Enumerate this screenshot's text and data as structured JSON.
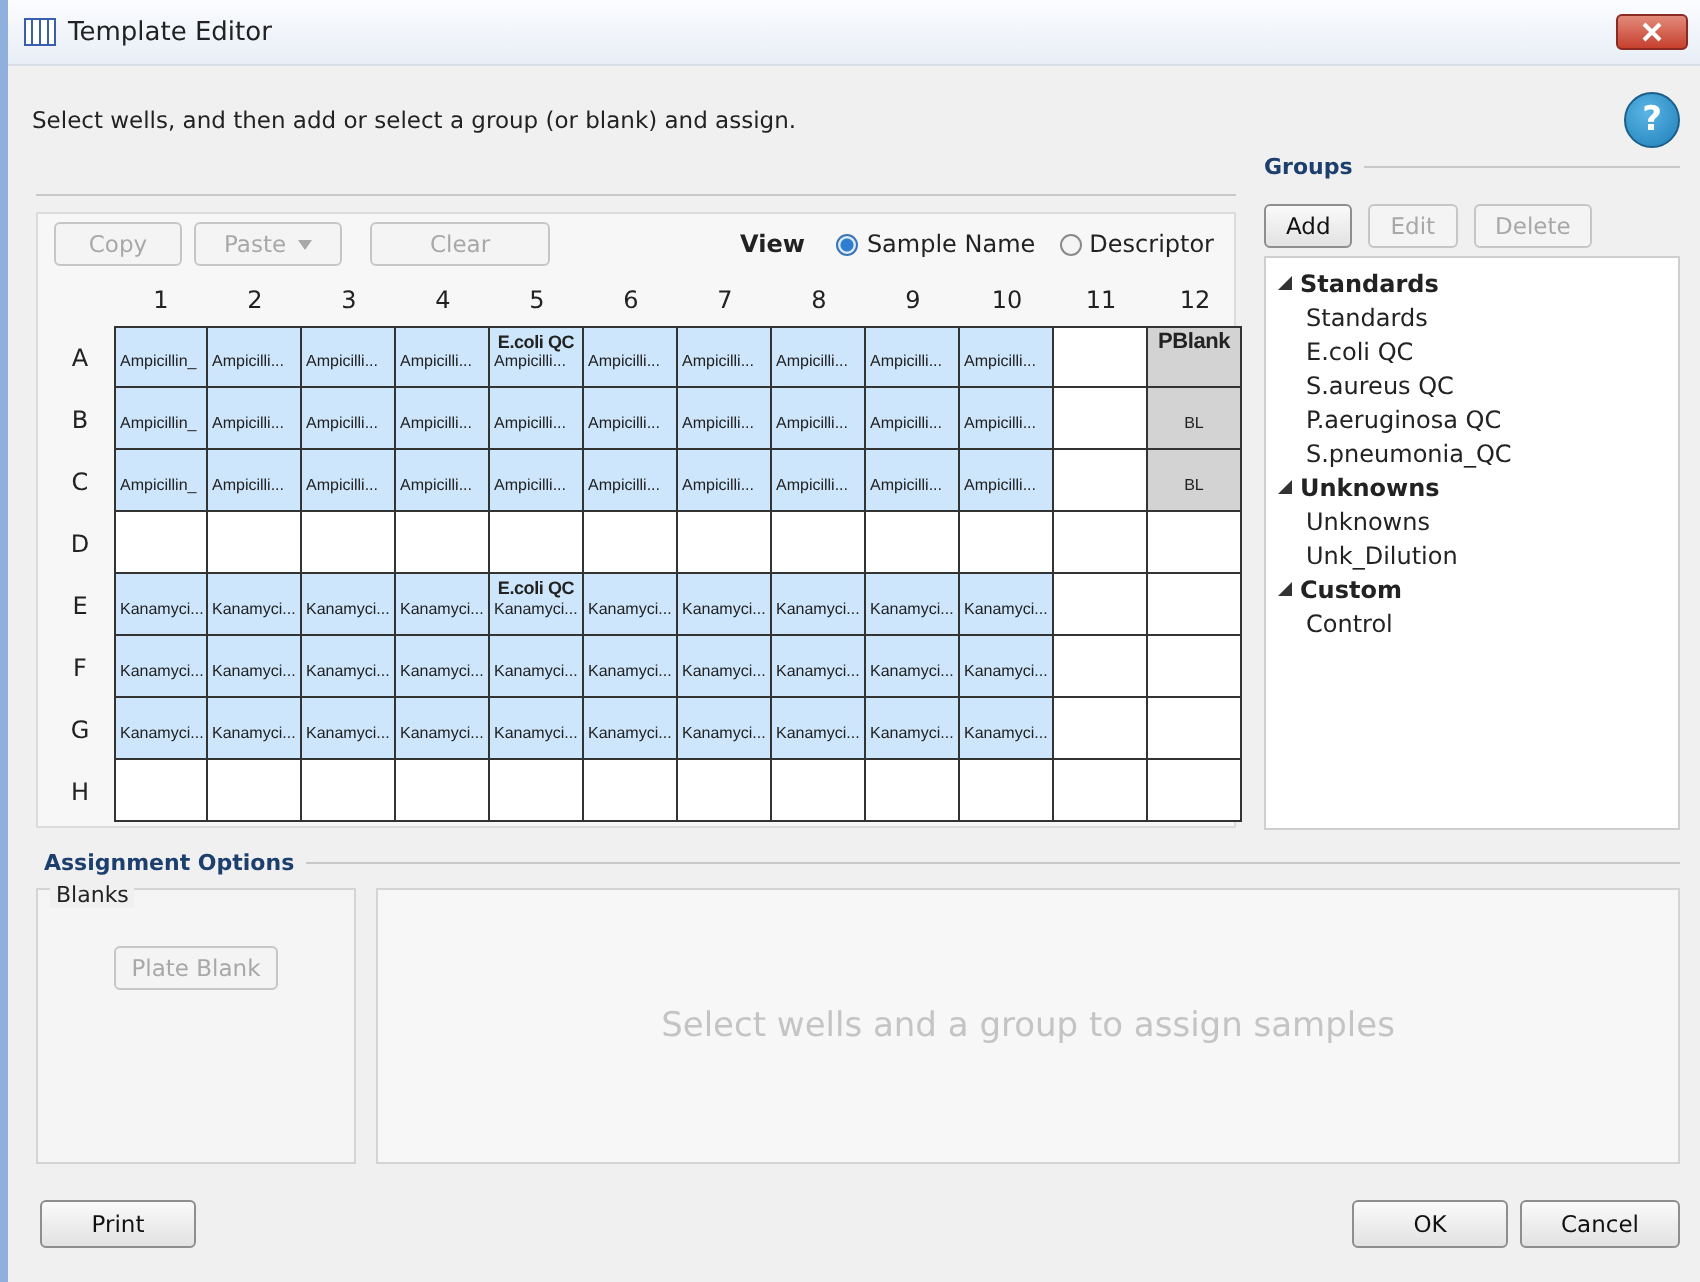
{
  "window": {
    "title": "Template Editor"
  },
  "instruction": "Select wells, and then add or select a group (or blank) and assign.",
  "help": "?",
  "toolbar": {
    "buttons": [
      {
        "label": "Copy",
        "disabled": true,
        "dropdown": false
      },
      {
        "label": "Paste",
        "disabled": true,
        "dropdown": true
      },
      {
        "label": "Clear",
        "disabled": true,
        "dropdown": false
      }
    ],
    "view_label": "View",
    "view_options": [
      {
        "label": "Sample Name",
        "selected": true
      },
      {
        "label": "Descriptor",
        "selected": false
      }
    ]
  },
  "plate": {
    "columns": [
      "1",
      "2",
      "3",
      "4",
      "5",
      "6",
      "7",
      "8",
      "9",
      "10",
      "11",
      "12"
    ],
    "rows": [
      {
        "label": "A",
        "wells": [
          {
            "kind": "sample",
            "text": "Ampicillin_"
          },
          {
            "kind": "sample",
            "text": "Ampicilli..."
          },
          {
            "kind": "sample",
            "text": "Ampicilli..."
          },
          {
            "kind": "sample",
            "text": "Ampicilli..."
          },
          {
            "kind": "sample",
            "text": "Ampicilli...",
            "group_label": "E.coli QC"
          },
          {
            "kind": "sample",
            "text": "Ampicilli..."
          },
          {
            "kind": "sample",
            "text": "Ampicilli..."
          },
          {
            "kind": "sample",
            "text": "Ampicilli..."
          },
          {
            "kind": "sample",
            "text": "Ampicilli..."
          },
          {
            "kind": "sample",
            "text": "Ampicilli..."
          },
          {
            "kind": "empty"
          },
          {
            "kind": "blank",
            "group_label": "PBlank"
          }
        ]
      },
      {
        "label": "B",
        "wells": [
          {
            "kind": "sample",
            "text": "Ampicillin_"
          },
          {
            "kind": "sample",
            "text": "Ampicilli..."
          },
          {
            "kind": "sample",
            "text": "Ampicilli..."
          },
          {
            "kind": "sample",
            "text": "Ampicilli..."
          },
          {
            "kind": "sample",
            "text": "Ampicilli..."
          },
          {
            "kind": "sample",
            "text": "Ampicilli..."
          },
          {
            "kind": "sample",
            "text": "Ampicilli..."
          },
          {
            "kind": "sample",
            "text": "Ampicilli..."
          },
          {
            "kind": "sample",
            "text": "Ampicilli..."
          },
          {
            "kind": "sample",
            "text": "Ampicilli..."
          },
          {
            "kind": "empty"
          },
          {
            "kind": "blank",
            "text": "BL"
          }
        ]
      },
      {
        "label": "C",
        "wells": [
          {
            "kind": "sample",
            "text": "Ampicillin_"
          },
          {
            "kind": "sample",
            "text": "Ampicilli..."
          },
          {
            "kind": "sample",
            "text": "Ampicilli..."
          },
          {
            "kind": "sample",
            "text": "Ampicilli..."
          },
          {
            "kind": "sample",
            "text": "Ampicilli..."
          },
          {
            "kind": "sample",
            "text": "Ampicilli..."
          },
          {
            "kind": "sample",
            "text": "Ampicilli..."
          },
          {
            "kind": "sample",
            "text": "Ampicilli..."
          },
          {
            "kind": "sample",
            "text": "Ampicilli..."
          },
          {
            "kind": "sample",
            "text": "Ampicilli..."
          },
          {
            "kind": "empty"
          },
          {
            "kind": "blank",
            "text": "BL"
          }
        ]
      },
      {
        "label": "D",
        "wells": [
          {
            "kind": "empty"
          },
          {
            "kind": "empty"
          },
          {
            "kind": "empty"
          },
          {
            "kind": "empty"
          },
          {
            "kind": "empty"
          },
          {
            "kind": "empty"
          },
          {
            "kind": "empty"
          },
          {
            "kind": "empty"
          },
          {
            "kind": "empty"
          },
          {
            "kind": "empty"
          },
          {
            "kind": "empty"
          },
          {
            "kind": "empty"
          }
        ]
      },
      {
        "label": "E",
        "wells": [
          {
            "kind": "sample",
            "text": "Kanamyci..."
          },
          {
            "kind": "sample",
            "text": "Kanamyci..."
          },
          {
            "kind": "sample",
            "text": "Kanamyci..."
          },
          {
            "kind": "sample",
            "text": "Kanamyci..."
          },
          {
            "kind": "sample",
            "text": "Kanamyci...",
            "group_label": "E.coli QC"
          },
          {
            "kind": "sample",
            "text": "Kanamyci..."
          },
          {
            "kind": "sample",
            "text": "Kanamyci..."
          },
          {
            "kind": "sample",
            "text": "Kanamyci..."
          },
          {
            "kind": "sample",
            "text": "Kanamyci..."
          },
          {
            "kind": "sample",
            "text": "Kanamyci..."
          },
          {
            "kind": "empty"
          },
          {
            "kind": "empty"
          }
        ]
      },
      {
        "label": "F",
        "wells": [
          {
            "kind": "sample",
            "text": "Kanamyci..."
          },
          {
            "kind": "sample",
            "text": "Kanamyci..."
          },
          {
            "kind": "sample",
            "text": "Kanamyci..."
          },
          {
            "kind": "sample",
            "text": "Kanamyci..."
          },
          {
            "kind": "sample",
            "text": "Kanamyci..."
          },
          {
            "kind": "sample",
            "text": "Kanamyci..."
          },
          {
            "kind": "sample",
            "text": "Kanamyci..."
          },
          {
            "kind": "sample",
            "text": "Kanamyci..."
          },
          {
            "kind": "sample",
            "text": "Kanamyci..."
          },
          {
            "kind": "sample",
            "text": "Kanamyci..."
          },
          {
            "kind": "empty"
          },
          {
            "kind": "empty"
          }
        ]
      },
      {
        "label": "G",
        "wells": [
          {
            "kind": "sample",
            "text": "Kanamyci..."
          },
          {
            "kind": "sample",
            "text": "Kanamyci..."
          },
          {
            "kind": "sample",
            "text": "Kanamyci..."
          },
          {
            "kind": "sample",
            "text": "Kanamyci..."
          },
          {
            "kind": "sample",
            "text": "Kanamyci..."
          },
          {
            "kind": "sample",
            "text": "Kanamyci..."
          },
          {
            "kind": "sample",
            "text": "Kanamyci..."
          },
          {
            "kind": "sample",
            "text": "Kanamyci..."
          },
          {
            "kind": "sample",
            "text": "Kanamyci..."
          },
          {
            "kind": "sample",
            "text": "Kanamyci..."
          },
          {
            "kind": "empty"
          },
          {
            "kind": "empty"
          }
        ]
      },
      {
        "label": "H",
        "wells": [
          {
            "kind": "empty"
          },
          {
            "kind": "empty"
          },
          {
            "kind": "empty"
          },
          {
            "kind": "empty"
          },
          {
            "kind": "empty"
          },
          {
            "kind": "empty"
          },
          {
            "kind": "empty"
          },
          {
            "kind": "empty"
          },
          {
            "kind": "empty"
          },
          {
            "kind": "empty"
          },
          {
            "kind": "empty"
          },
          {
            "kind": "empty"
          }
        ]
      }
    ]
  },
  "groups": {
    "title": "Groups",
    "buttons": [
      {
        "label": "Add",
        "disabled": false
      },
      {
        "label": "Edit",
        "disabled": true
      },
      {
        "label": "Delete",
        "disabled": true
      }
    ],
    "tree": [
      {
        "label": "Standards",
        "expanded": true,
        "children": [
          {
            "label": "Standards"
          },
          {
            "label": "E.coli QC"
          },
          {
            "label": "S.aureus QC"
          },
          {
            "label": "P.aeruginosa QC"
          },
          {
            "label": "S.pneumonia_QC"
          }
        ]
      },
      {
        "label": "Unknowns",
        "expanded": true,
        "children": [
          {
            "label": "Unknowns"
          },
          {
            "label": "Unk_Dilution"
          }
        ]
      },
      {
        "label": "Custom",
        "expanded": true,
        "children": [
          {
            "label": "Control"
          }
        ]
      }
    ]
  },
  "assignment": {
    "title": "Assignment Options",
    "blanks": {
      "title": "Blanks",
      "button": {
        "label": "Plate Blank",
        "disabled": true
      }
    },
    "message": "Select wells and a group to assign samples"
  },
  "footer": {
    "left": [
      {
        "label": "Print"
      }
    ],
    "right": [
      {
        "label": "OK"
      },
      {
        "label": "Cancel"
      }
    ]
  }
}
